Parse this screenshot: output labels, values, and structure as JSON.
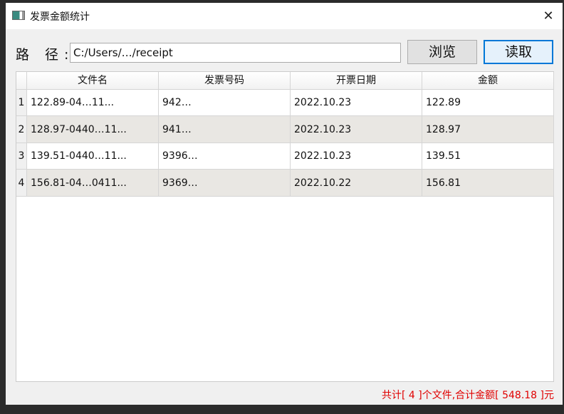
{
  "window": {
    "title": "发票金额统计",
    "close": "✕"
  },
  "path": {
    "label": "路 径:",
    "value": "C:/Users/…/receipt"
  },
  "buttons": {
    "browse": "浏览",
    "read": "读取"
  },
  "table": {
    "headers": [
      "文件名",
      "发票号码",
      "开票日期",
      "金额"
    ],
    "rows": [
      {
        "n": "1",
        "file": "122.89-04…11...",
        "number": "942…",
        "date": "2022.10.23",
        "amount": "122.89"
      },
      {
        "n": "2",
        "file": "128.97-0440…11...",
        "number": "941…",
        "date": "2022.10.23",
        "amount": "128.97"
      },
      {
        "n": "3",
        "file": "139.51-0440…11...",
        "number": "9396…",
        "date": "2022.10.23",
        "amount": "139.51"
      },
      {
        "n": "4",
        "file": "156.81-04…0411...",
        "number": "9369…",
        "date": "2022.10.22",
        "amount": "156.81"
      }
    ]
  },
  "status": "共计[ 4 ]个文件,合计金额[ 548.18 ]元"
}
